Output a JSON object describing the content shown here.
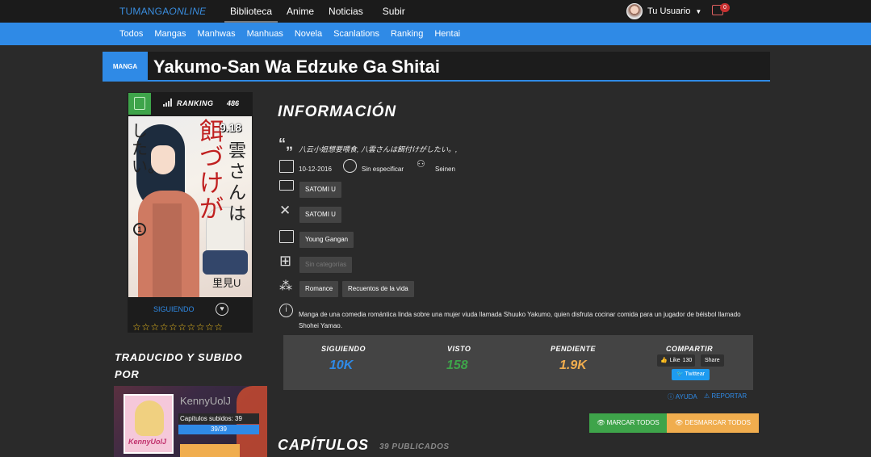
{
  "site": {
    "logo_main": "TUMANGA",
    "logo_sub": "ONLINE"
  },
  "topnav": [
    {
      "label": "Biblioteca"
    },
    {
      "label": "Anime"
    },
    {
      "label": "Noticias"
    },
    {
      "label": "Subir"
    }
  ],
  "user": {
    "name": "Tu Usuario",
    "notifications": "0"
  },
  "subnav": [
    {
      "label": "Todos"
    },
    {
      "label": "Mangas"
    },
    {
      "label": "Manhwas"
    },
    {
      "label": "Manhuas"
    },
    {
      "label": "Novela"
    },
    {
      "label": "Scanlations"
    },
    {
      "label": "Ranking"
    },
    {
      "label": "Hentai"
    }
  ],
  "manga": {
    "type": "MANGA",
    "title": "Yakumo-San Wa Edzuke Ga Shitai",
    "ranking_label": "RANKING",
    "ranking_value": "486",
    "score": "9.18",
    "follow_label": "SIGUIENDO",
    "stars": "☆☆☆☆☆☆☆☆☆☆"
  },
  "cover": {
    "title_jp_1": "したい。",
    "title_jp_2": "雲さんは",
    "title_red": "餌づけが",
    "vol": "1",
    "author": "里見U"
  },
  "info": {
    "heading": "INFORMACIÓN",
    "alt_names": "八云小姐想要喂食, 八雲さんは餌付けがしたい。,",
    "date": "10-12-2016",
    "period": "Sin especificar",
    "demographic": "Seinen",
    "author": "SATOMI U",
    "artist": "SATOMI U",
    "magazine": "Young Gangan",
    "categories": "Sin categorías",
    "genres": [
      "Romance",
      "Recuentos de la vida"
    ],
    "description": "Manga de una comedia romántica linda sobre una mujer viuda llamada Shuuko Yakumo, quien disfruta cocinar comida para un jugador de béisbol llamado Shohei Yamao."
  },
  "stats": {
    "following_label": "SIGUIENDO",
    "following_value": "10K",
    "seen_label": "VISTO",
    "seen_value": "158",
    "pending_label": "PENDIENTE",
    "pending_value": "1.9K",
    "share_label": "COMPARTIR",
    "like_label": "Like",
    "like_count": "130",
    "share_btn": "Share",
    "tweet_btn": "Twittear",
    "colors": {
      "following": "#2f8ae6",
      "seen": "#3ea44a",
      "pending": "#f0ad4e"
    }
  },
  "links": {
    "help": "AYUDA",
    "report": "REPORTAR"
  },
  "actions": {
    "mark_all": "MARCAR TODOS",
    "unmark_all": "DESMARCAR TODOS"
  },
  "chapters": {
    "heading": "CAPÍTULOS",
    "count": "39 PUBLICADOS"
  },
  "uploaded": {
    "heading": "TRADUCIDO Y SUBIDO POR",
    "name": "KennyUolJ",
    "avatar_text": "KennyUolJ",
    "chapters": "Capítulos subidos: 39",
    "progress": "39/39"
  }
}
